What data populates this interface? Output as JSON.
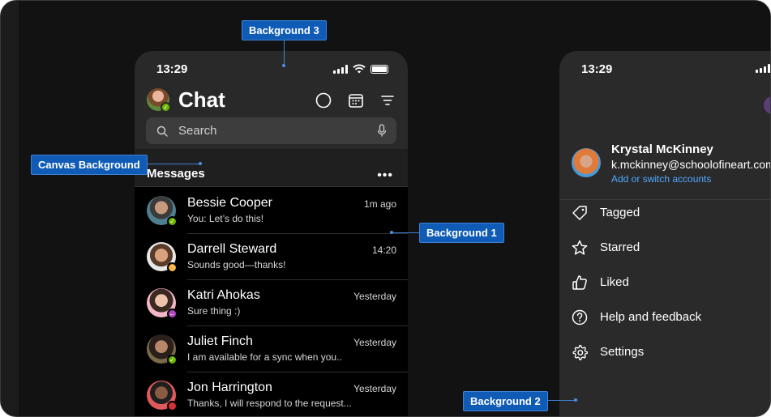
{
  "callouts": {
    "background3": "Background 3",
    "canvas": "Canvas Background",
    "background1": "Background 1",
    "background2": "Background 2"
  },
  "phone1": {
    "time": "13:29",
    "title": "Chat",
    "search_placeholder": "Search",
    "section_title": "Messages",
    "more_label": "•••",
    "icons": [
      "status-circle-icon",
      "calendar-icon",
      "filter-icon",
      "search-icon",
      "microphone-icon"
    ],
    "chats": [
      {
        "name": "Bessie Cooper",
        "preview": "You: Let’s do this!",
        "time": "1m ago",
        "presence": "available"
      },
      {
        "name": "Darrell Steward",
        "preview": "Sounds good—thanks!",
        "time": "14:20",
        "presence": "away"
      },
      {
        "name": "Katri Ahokas",
        "preview": "Sure thing :)",
        "time": "Yesterday",
        "presence": "out-of-office"
      },
      {
        "name": "Juliet Finch",
        "preview": "I am available for a sync when you..",
        "time": "Yesterday",
        "presence": "available"
      },
      {
        "name": "Jon Harrington",
        "preview": "Thanks, I will respond to the request...",
        "time": "Yesterday",
        "presence": "busy"
      }
    ]
  },
  "phone2": {
    "time": "13:29",
    "account": {
      "name": "Krystal McKinney",
      "email": "k.mckinney@schoolofineart.com",
      "switch_label": "Add or switch accounts"
    },
    "menu": [
      {
        "label": "Tagged",
        "icon": "tag-icon"
      },
      {
        "label": "Starred",
        "icon": "star-icon"
      },
      {
        "label": "Liked",
        "icon": "thumbs-up-icon"
      },
      {
        "label": "Help and feedback",
        "icon": "help-icon"
      },
      {
        "label": "Settings",
        "icon": "gear-icon"
      }
    ]
  },
  "colors": {
    "frame": "#1c1c1c",
    "background1": "#000000",
    "background2": "#2a2a2a",
    "background3": "#292929",
    "canvas": "#1f1f1f",
    "callout": "#0f5bb5",
    "link": "#4fa8ff",
    "available": "#6bb700",
    "away": "#f8a11d",
    "out_of_office": "#b146c2",
    "busy": "#d13438"
  }
}
